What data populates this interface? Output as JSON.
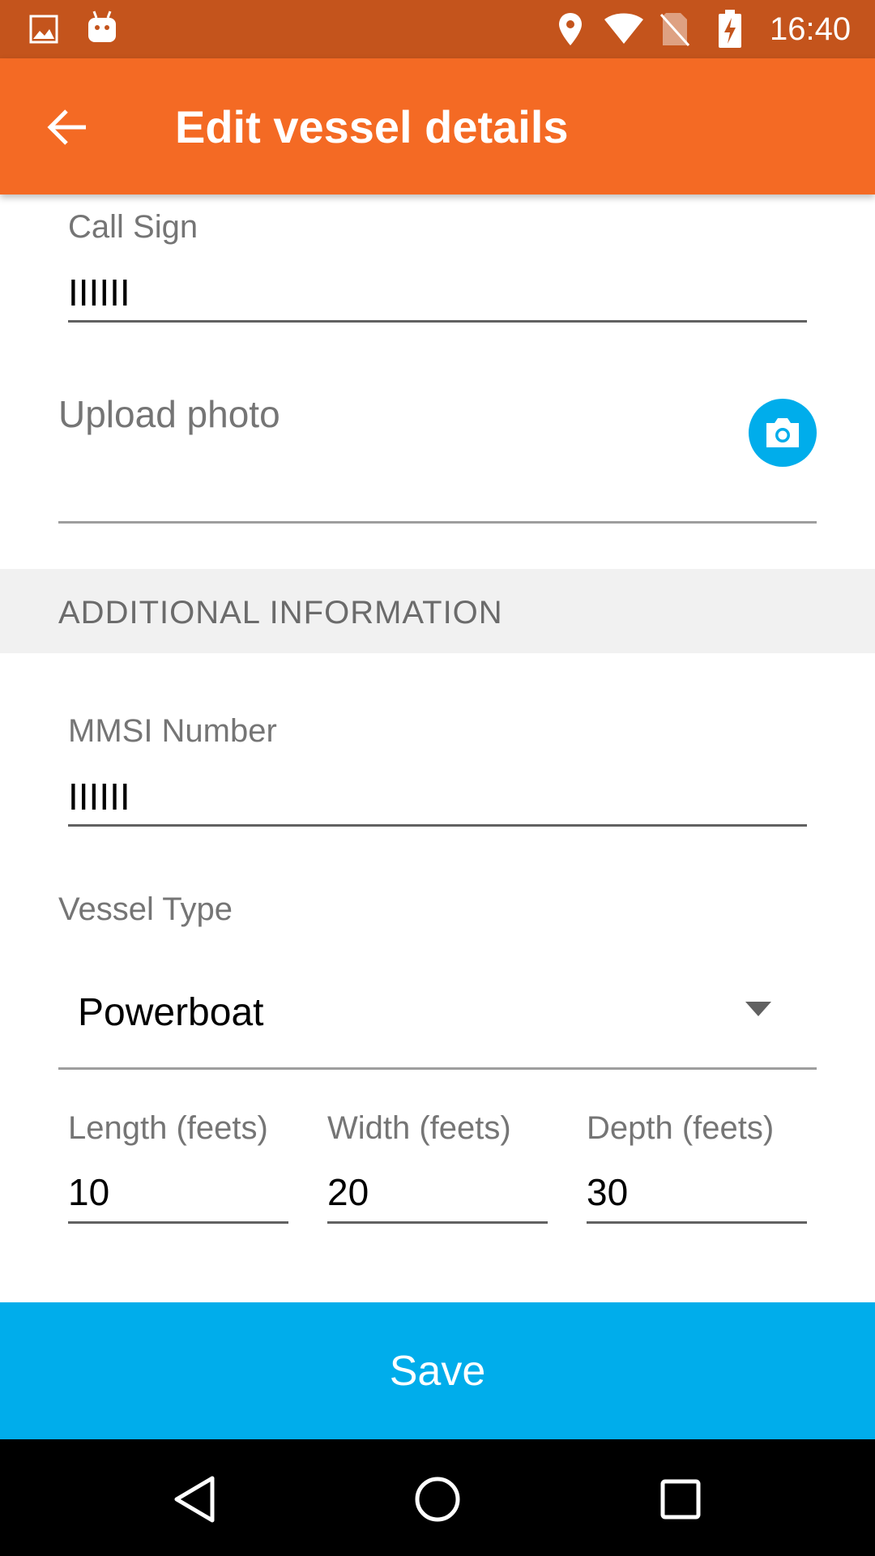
{
  "status_bar": {
    "time": "16:40"
  },
  "app_bar": {
    "title": "Edit vessel details"
  },
  "form": {
    "call_sign": {
      "label": "Call Sign",
      "value": "IIIIII"
    },
    "upload_photo": {
      "label": "Upload photo"
    },
    "section_title": "ADDITIONAL INFORMATION",
    "mmsi": {
      "label": "MMSI Number",
      "value": "IIIIII"
    },
    "vessel_type": {
      "label": "Vessel Type",
      "selected": "Powerboat"
    },
    "length": {
      "label": "Length (feets)",
      "value": "10"
    },
    "width": {
      "label": "Width (feets)",
      "value": "20"
    },
    "depth": {
      "label": "Depth (feets)",
      "value": "30"
    }
  },
  "actions": {
    "save_label": "Save"
  },
  "colors": {
    "status_bar": "#c4541c",
    "app_bar": "#f46a24",
    "accent": "#00adeb",
    "nav_bar": "#000000"
  },
  "icons": [
    "image-icon",
    "android-icon",
    "location-icon",
    "wifi-icon",
    "no-sim-icon",
    "battery-charging-icon",
    "back-arrow-icon",
    "camera-icon",
    "dropdown-arrow-icon",
    "nav-back-icon",
    "nav-home-icon",
    "nav-recents-icon"
  ]
}
